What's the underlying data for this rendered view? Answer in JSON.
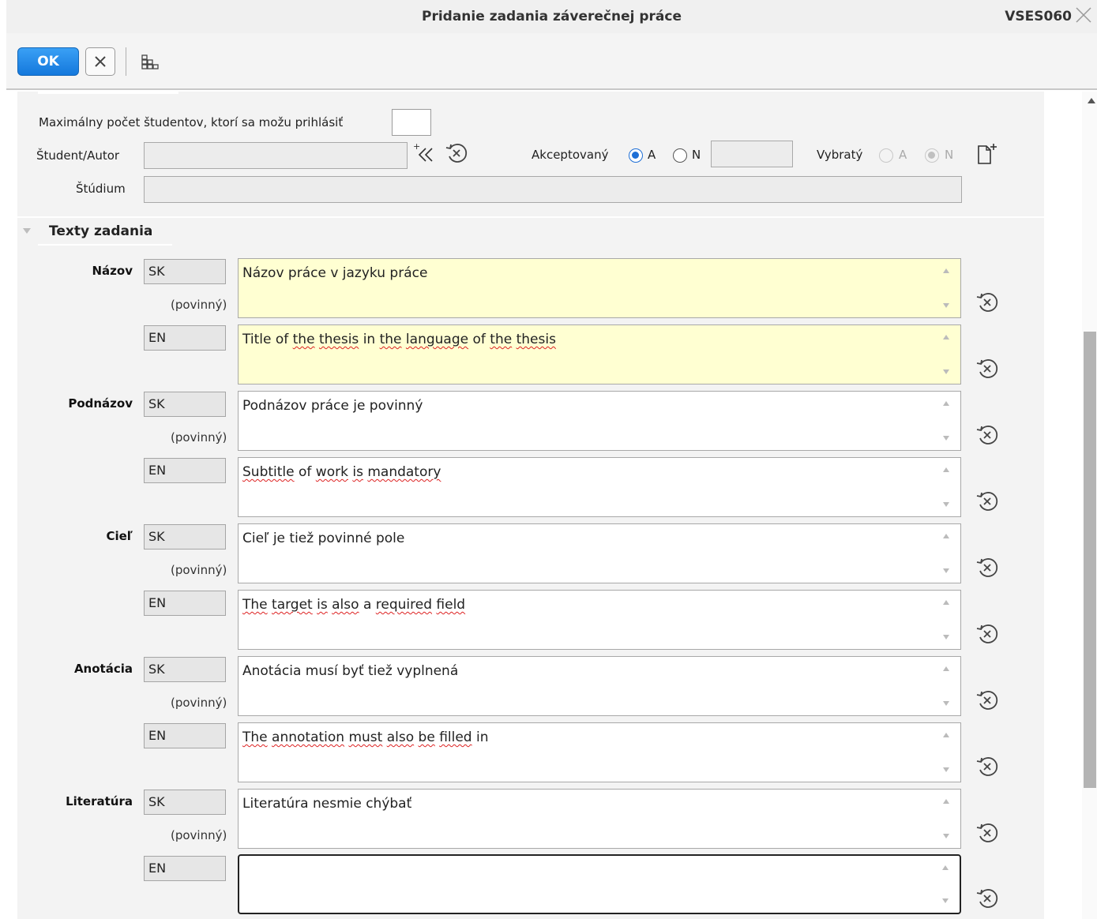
{
  "window": {
    "title": "Pridanie zadania záverečnej práce",
    "code": "VSES060"
  },
  "toolbar": {
    "ok_label": "OK"
  },
  "form": {
    "max_students_label": "Maximálny počet študentov, ktorí sa možu prihlásiť",
    "max_students_value": "",
    "student_label": "Študent/Autor",
    "student_value": "",
    "accepted_label": "Akceptovaný",
    "accepted_options": [
      "A",
      "N"
    ],
    "accepted_selected": "A",
    "accepted_extra_value": "",
    "selected_label": "Vybratý",
    "selected_options": [
      "A",
      "N"
    ],
    "selected_selected": "N",
    "study_label": "Štúdium",
    "study_value": ""
  },
  "section": {
    "title": "Texty zadania",
    "required_hint": "(povinný)",
    "fields": [
      {
        "label": "Názov",
        "rows": [
          {
            "lang": "SK",
            "text": "Názov práce v jazyku práce",
            "required": true
          },
          {
            "lang": "EN",
            "text": "Title of the thesis in the language of the thesis"
          }
        ]
      },
      {
        "label": "Podnázov",
        "rows": [
          {
            "lang": "SK",
            "text": "Podnázov práce je povinný",
            "required": true
          },
          {
            "lang": "EN",
            "text": "Subtitle of work is mandatory"
          }
        ]
      },
      {
        "label": "Cieľ",
        "rows": [
          {
            "lang": "SK",
            "text": "Cieľ je tiež povinné pole",
            "required": true
          },
          {
            "lang": "EN",
            "text": "The target is also a required field"
          }
        ]
      },
      {
        "label": "Anotácia",
        "rows": [
          {
            "lang": "SK",
            "text": "Anotácia musí byť  tiež vyplnená",
            "required": true
          },
          {
            "lang": "EN",
            "text": "The annotation must also be filled in"
          }
        ]
      },
      {
        "label": "Literatúra",
        "rows": [
          {
            "lang": "SK",
            "text": "Literatúra nesmie chýbať",
            "required": true
          },
          {
            "lang": "EN",
            "text": ""
          }
        ]
      }
    ]
  },
  "icons": {
    "close": "close-icon",
    "cancel": "cancel-x-icon",
    "grid": "grid-layout-icon",
    "add_from_list": "add-from-list-icon",
    "reset": "reset-icon",
    "new_document": "new-document-icon",
    "collapse": "collapse-triangle-icon"
  },
  "colors": {
    "ok_button": "#1e88e5",
    "required_field_bg": "#ffffd2",
    "radio_selected": "#1e6fd6"
  }
}
